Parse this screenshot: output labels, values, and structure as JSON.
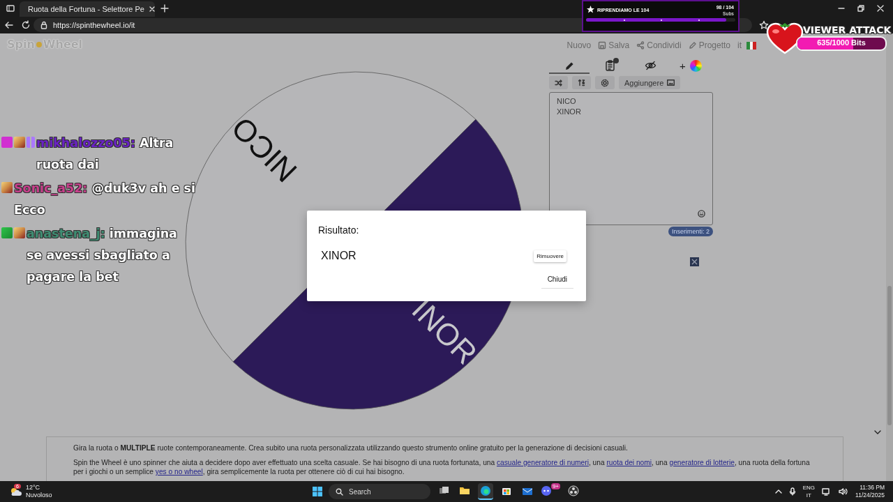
{
  "browser": {
    "tab_title": "Ruota della Fortuna - Selettore Pe",
    "url": "https://spinthewheel.io/it"
  },
  "site": {
    "logo": [
      "Spin",
      "Wheel"
    ],
    "nav": [
      {
        "label": "Nuovo",
        "kind": "plain"
      },
      {
        "label": "Salva",
        "kind": "save"
      },
      {
        "label": "Condividi",
        "kind": "share"
      },
      {
        "label": "Progetto",
        "kind": "pencil"
      },
      {
        "label": "it",
        "kind": "flag"
      }
    ]
  },
  "wheel": {
    "segments": [
      {
        "label": "NICO",
        "color": "#b6b6b8"
      },
      {
        "label": "INOR",
        "color": "#2c1a58"
      }
    ]
  },
  "editor": {
    "tabs": [
      {
        "kind": "edit",
        "selected": true
      },
      {
        "kind": "results",
        "selected": false
      },
      {
        "kind": "hide",
        "selected": false
      },
      {
        "kind": "colors",
        "label": "+",
        "selected": false
      }
    ],
    "tools": [
      {
        "kind": "shuffle"
      },
      {
        "kind": "sort"
      },
      {
        "kind": "settings"
      },
      {
        "kind": "add-image",
        "label": "Aggiungere"
      }
    ],
    "entries": [
      "NICO",
      "XINOR"
    ],
    "count": "Inserimenti: 2"
  },
  "dialog": {
    "title": "Risultato:",
    "result": "XINOR",
    "remove": "Rimuovere",
    "close": "Chiudi"
  },
  "about": {
    "intro": "Gira la ruota o **MULTIPLE** ruote contemporaneamente. Crea subito una ruota personalizzata utilizzando questo strumento online gratuito per la generazione di decisioni casuali.",
    "body": [
      {
        "text": "Spin the Wheel è uno spinner che aiuta a decidere dopo aver effettuato una scelta casuale. Se hai bisogno di una ruota fortunata, una ",
        "link": false
      },
      {
        "text": "casuale generatore di numeri",
        "link": true
      },
      {
        "text": ", una ",
        "link": false
      },
      {
        "text": "ruota dei nomi",
        "link": true
      },
      {
        "text": ", una ",
        "link": false
      },
      {
        "text": "generatore di lotterie",
        "link": true
      },
      {
        "text": ", una ruota della fortuna per i giochi o un semplice ",
        "link": false
      },
      {
        "text": "yes o no wheel",
        "link": true
      },
      {
        "text": ", gira semplicemente la ruota per ottenere ciò di cui hai bisogno.",
        "link": false
      }
    ]
  },
  "chat": [
    {
      "badges": [
        {
          "kind": "gem"
        },
        {
          "kind": "avatar"
        },
        {
          "kind": "subscriber"
        }
      ],
      "user": "mikhalozzo05:",
      "color": "#6a22c4",
      "message": "Altra ruota dai"
    },
    {
      "badges": [
        {
          "kind": "avatar"
        }
      ],
      "user": "Sonic_a52:",
      "color": "#c8408c",
      "message": "@duk3v ah e si Ecco"
    },
    {
      "badges": [
        {
          "kind": "sword"
        },
        {
          "kind": "avatar"
        }
      ],
      "user": "anastena_j:",
      "color": "#3f8c72",
      "message": "immagina se avessi sbagliato a pagare la bet"
    }
  ],
  "sub_goal": {
    "title": "RIPRENDIAMO LE 104",
    "count": "98 / 104",
    "unit": "Subs",
    "level": 0.94
  },
  "bits_goal": {
    "title": "VIEWER ATTACK",
    "count": "635/1000 Bits",
    "level": 0.635
  },
  "taskbar": {
    "weather": {
      "temperature": "12°C",
      "condition": "Nuvoloso",
      "badge": "6"
    },
    "search": {
      "placeholder": "Search"
    },
    "apps": [
      {
        "kind": "task-view",
        "selected": false
      },
      {
        "kind": "folder",
        "selected": false
      },
      {
        "kind": "browser",
        "selected": true
      },
      {
        "kind": "store",
        "selected": false
      },
      {
        "kind": "mail",
        "selected": false
      },
      {
        "kind": "chat",
        "selected": false,
        "badge": "9+"
      },
      {
        "kind": "recorder",
        "selected": false
      }
    ],
    "language": [
      "ENG",
      "IT"
    ],
    "time": "11:36 PM",
    "date": "11/24/2025"
  }
}
